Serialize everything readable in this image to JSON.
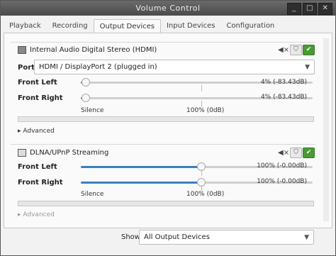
{
  "window": {
    "title": "Volume Control",
    "buttons": [
      "_",
      "□",
      "✕"
    ]
  },
  "tabs": [
    "Playback",
    "Recording",
    "Output Devices",
    "Input Devices",
    "Configuration"
  ],
  "active_tab": "Output Devices",
  "devices": [
    {
      "name": "Internal Audio Digital Stereo (HDMI)",
      "port_label": "Port:",
      "port_value": "HDMI / DisplayPort 2 (plugged in)",
      "channels": [
        {
          "label": "Front Left",
          "value_text": "4% (-83.43dB)",
          "level": 0.04
        },
        {
          "label": "Front Right",
          "value_text": "4% (-83.43dB)",
          "level": 0.04
        }
      ],
      "scale": {
        "silence": "Silence",
        "hundred": "100% (0dB)"
      },
      "advanced": "Advanced"
    },
    {
      "name": "DLNA/UPnP Streaming",
      "channels": [
        {
          "label": "Front Left",
          "value_text": "100% (-0.00dB)",
          "level": 1.0
        },
        {
          "label": "Front Right",
          "value_text": "100% (-0.00dB)",
          "level": 1.0
        }
      ],
      "scale": {
        "silence": "Silence",
        "hundred": "100% (0dB)"
      },
      "advanced": "Advanced"
    }
  ],
  "show": {
    "label": "Show:",
    "value": "All Output Devices"
  },
  "colors": {
    "accent": "#3b7fc4",
    "ok": "#4a9a34"
  }
}
